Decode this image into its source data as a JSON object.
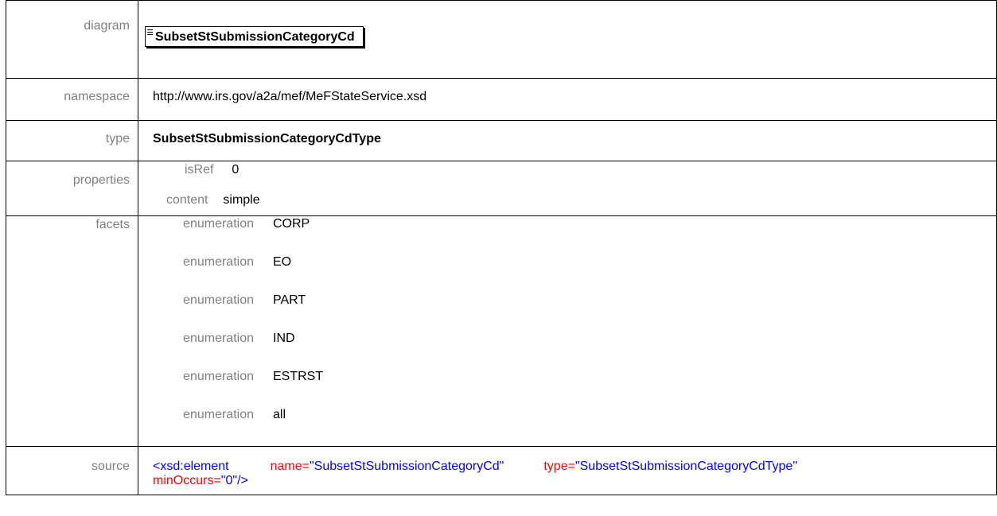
{
  "rows": {
    "diagram": {
      "label": "diagram",
      "element_name": "SubsetStSubmissionCategoryCd"
    },
    "namespace": {
      "label": "namespace",
      "value": "http://www.irs.gov/a2a/mef/MeFStateService.xsd"
    },
    "type": {
      "label": "type",
      "value": "SubsetStSubmissionCategoryCdType"
    },
    "properties": {
      "label": "properties",
      "items": [
        {
          "key": "isRef",
          "value": "0"
        },
        {
          "key": "content",
          "value": "simple"
        }
      ]
    },
    "facets": {
      "label": "facets",
      "items": [
        {
          "key": "enumeration",
          "value": "CORP"
        },
        {
          "key": "enumeration",
          "value": "EO"
        },
        {
          "key": "enumeration",
          "value": "PART"
        },
        {
          "key": "enumeration",
          "value": "IND"
        },
        {
          "key": "enumeration",
          "value": "ESTRST"
        },
        {
          "key": "enumeration",
          "value": "all"
        }
      ]
    },
    "source": {
      "label": "source",
      "tag_open": "<xsd:element",
      "attr_name": "name=",
      "name_value": "\"SubsetStSubmissionCategoryCd\"",
      "attr_type": "type=",
      "type_value": "\"SubsetStSubmissionCategoryCdType\"",
      "attr_minoccurs": "minOccurs=",
      "minoccurs_value": "\"0\"",
      "tag_close": "/>"
    }
  },
  "colors": {
    "label_gray": "#808080",
    "xml_tag_blue": "#0000ff",
    "xml_attr_red": "#ff0000"
  }
}
